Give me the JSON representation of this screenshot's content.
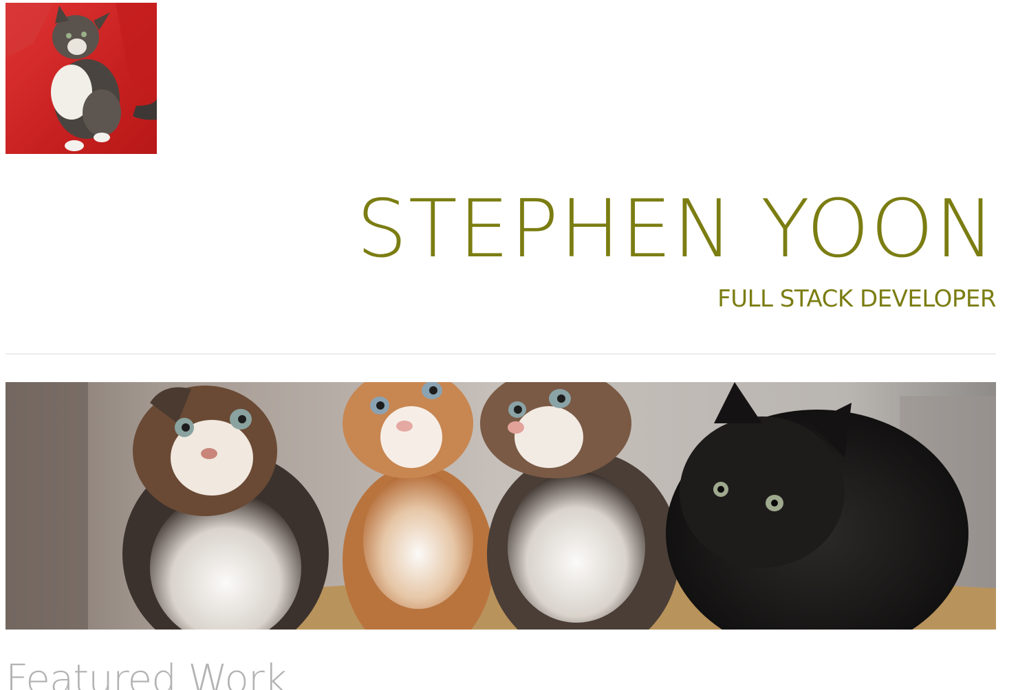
{
  "header": {
    "logo_icon": "kitten-on-red-chair-photo",
    "name": "STEPHEN YOON",
    "subtitle": "FULL STACK DEVELOPER"
  },
  "banner": {
    "image": "four-kittens-photo"
  },
  "main": {
    "section_heading": "Featured Work"
  },
  "colors": {
    "accent": "#7b7d12",
    "divider": "#ececec",
    "heading_gray": "#b3b3b3",
    "logo_background": "#d42a2a"
  }
}
